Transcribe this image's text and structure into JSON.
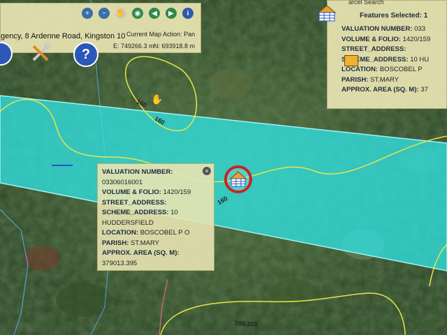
{
  "toolbar": {
    "address_text": "gency, 8 Ardenne Road, Kingston 10",
    "map_action_label": "Current Map Action:",
    "map_action_value": "Pan",
    "east_label": "E:",
    "east_value": "749266.3 m",
    "north_label": "N:",
    "north_value": "693918.8 m",
    "tools": [
      "zoom-in",
      "zoom-out",
      "pan",
      "full-extent",
      "previous-extent",
      "next-extent",
      "info"
    ]
  },
  "features_panel": {
    "header_partial": "arcel Search",
    "title": "Features Selected: 1",
    "fields": [
      {
        "label": "VALUATION NUMBER:",
        "value": "033"
      },
      {
        "label": "VOLUME & FOLIO:",
        "value": "1420/159"
      },
      {
        "label": "STREET_ADDRESS:",
        "value": ""
      },
      {
        "label": "SCHEME_ADDRESS:",
        "value": "10 HU"
      },
      {
        "label": "LOCATION:",
        "value": "BOSCOBEL P"
      },
      {
        "label": "PARISH:",
        "value": "ST.MARY"
      },
      {
        "label": "APPROX. AREA (SQ. M):",
        "value": "37"
      }
    ]
  },
  "popup": {
    "close_symbol": "×",
    "valuation_label": "VALUATION NUMBER:",
    "valuation_value": "03306016001",
    "volume_label": "VOLUME & FOLIO:",
    "volume_value": "1420/159",
    "street_label": "STREET_ADDRESS:",
    "street_value": "",
    "scheme_label": "SCHEME_ADDRESS:",
    "scheme_value": "10",
    "scheme_value_2": "HUDDERSFIELD",
    "location_label": "LOCATION:",
    "location_value": "BOSCOBEL P O",
    "parish_label": "PARISH:",
    "parish_value": "ST.MARY",
    "area_label": "APPROX. AREA (SQ. M):",
    "area_value": "379013.395"
  },
  "map_labels": {
    "contour_160a": "160",
    "contour_160b": "160",
    "contour_160c": "160",
    "contour_200": "200.200"
  },
  "colors": {
    "parcel_fill": "#2fe0e0",
    "contour": "#e6e64a",
    "road_line": "#d86a7a",
    "panel_bg": "#e8e4b2",
    "marker_ring": "#cc2222"
  }
}
